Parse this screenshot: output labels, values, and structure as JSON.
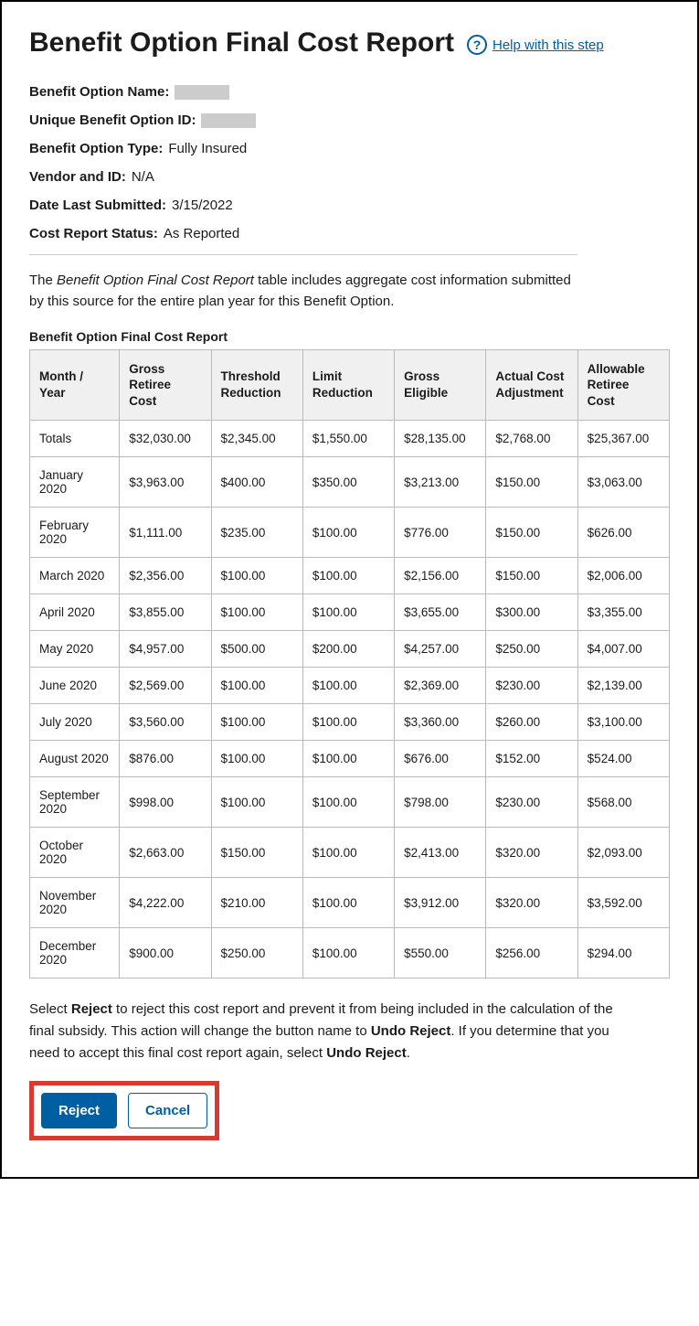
{
  "title": "Benefit Option Final Cost Report",
  "help_label": "Help with this step",
  "meta": {
    "name_label": "Benefit Option Name:",
    "id_label": "Unique Benefit Option ID:",
    "type_label": "Benefit Option Type:",
    "type_value": "Fully Insured",
    "vendor_label": "Vendor and ID:",
    "vendor_value": "N/A",
    "date_label": "Date Last Submitted:",
    "date_value": "3/15/2022",
    "status_label": "Cost Report Status:",
    "status_value": "As Reported"
  },
  "intro_prefix": "The ",
  "intro_em": "Benefit Option Final Cost Report",
  "intro_suffix": " table includes aggregate cost information submitted by this source for the entire plan year for this Benefit Option.",
  "table_title": "Benefit Option Final Cost Report",
  "columns": [
    "Month / Year",
    "Gross Retiree Cost",
    "Threshold Reduction",
    "Limit Reduction",
    "Gross Eligible",
    "Actual Cost Adjustment",
    "Allowable Retiree Cost"
  ],
  "rows": [
    {
      "month": "Totals",
      "v": [
        "$32,030.00",
        "$2,345.00",
        "$1,550.00",
        "$28,135.00",
        "$2,768.00",
        "$25,367.00"
      ]
    },
    {
      "month": "January 2020",
      "v": [
        "$3,963.00",
        "$400.00",
        "$350.00",
        "$3,213.00",
        "$150.00",
        "$3,063.00"
      ]
    },
    {
      "month": "February 2020",
      "v": [
        "$1,111.00",
        "$235.00",
        "$100.00",
        "$776.00",
        "$150.00",
        "$626.00"
      ]
    },
    {
      "month": "March 2020",
      "v": [
        "$2,356.00",
        "$100.00",
        "$100.00",
        "$2,156.00",
        "$150.00",
        "$2,006.00"
      ]
    },
    {
      "month": "April 2020",
      "v": [
        "$3,855.00",
        "$100.00",
        "$100.00",
        "$3,655.00",
        "$300.00",
        "$3,355.00"
      ]
    },
    {
      "month": "May 2020",
      "v": [
        "$4,957.00",
        "$500.00",
        "$200.00",
        "$4,257.00",
        "$250.00",
        "$4,007.00"
      ]
    },
    {
      "month": "June 2020",
      "v": [
        "$2,569.00",
        "$100.00",
        "$100.00",
        "$2,369.00",
        "$230.00",
        "$2,139.00"
      ]
    },
    {
      "month": "July 2020",
      "v": [
        "$3,560.00",
        "$100.00",
        "$100.00",
        "$3,360.00",
        "$260.00",
        "$3,100.00"
      ]
    },
    {
      "month": "August 2020",
      "v": [
        "$876.00",
        "$100.00",
        "$100.00",
        "$676.00",
        "$152.00",
        "$524.00"
      ]
    },
    {
      "month": "September 2020",
      "v": [
        "$998.00",
        "$100.00",
        "$100.00",
        "$798.00",
        "$230.00",
        "$568.00"
      ]
    },
    {
      "month": "October 2020",
      "v": [
        "$2,663.00",
        "$150.00",
        "$100.00",
        "$2,413.00",
        "$320.00",
        "$2,093.00"
      ]
    },
    {
      "month": "November 2020",
      "v": [
        "$4,222.00",
        "$210.00",
        "$100.00",
        "$3,912.00",
        "$320.00",
        "$3,592.00"
      ]
    },
    {
      "month": "December 2020",
      "v": [
        "$900.00",
        "$250.00",
        "$100.00",
        "$550.00",
        "$256.00",
        "$294.00"
      ]
    }
  ],
  "instr_p1": "Select ",
  "instr_b1": "Reject",
  "instr_p2": " to reject this cost report and prevent it from being included in the calculation of the final subsidy. This action will change the button name to ",
  "instr_b2": "Undo Reject",
  "instr_p3": ". If you determine that you need to accept this final cost report again, select ",
  "instr_b3": "Undo Reject",
  "instr_p4": ".",
  "buttons": {
    "reject": "Reject",
    "cancel": "Cancel"
  }
}
